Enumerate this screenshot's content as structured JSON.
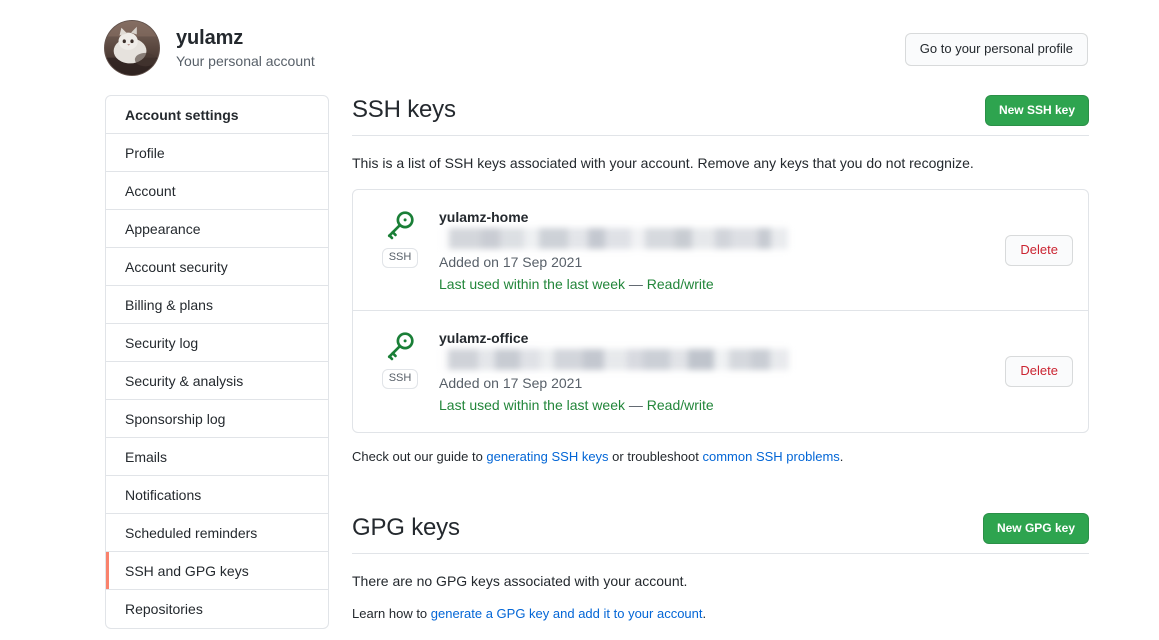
{
  "header": {
    "username": "yulamz",
    "subtitle": "Your personal account",
    "profile_button": "Go to your personal profile",
    "avatar_alt": "cat-avatar"
  },
  "sidebar": {
    "heading": "Account settings",
    "items": [
      {
        "label": "Profile",
        "active": false
      },
      {
        "label": "Account",
        "active": false
      },
      {
        "label": "Appearance",
        "active": false
      },
      {
        "label": "Account security",
        "active": false
      },
      {
        "label": "Billing & plans",
        "active": false
      },
      {
        "label": "Security log",
        "active": false
      },
      {
        "label": "Security & analysis",
        "active": false
      },
      {
        "label": "Sponsorship log",
        "active": false
      },
      {
        "label": "Emails",
        "active": false
      },
      {
        "label": "Notifications",
        "active": false
      },
      {
        "label": "Scheduled reminders",
        "active": false
      },
      {
        "label": "SSH and GPG keys",
        "active": true
      },
      {
        "label": "Repositories",
        "active": false
      }
    ],
    "active_accent_color": "#f9826c"
  },
  "ssh": {
    "title": "SSH keys",
    "new_button": "New SSH key",
    "description": "This is a list of SSH keys associated with your account. Remove any keys that you do not recognize.",
    "keys": [
      {
        "name": "yulamz-home",
        "fingerprint_redacted": true,
        "added": "Added on 17 Sep 2021",
        "last_used": "Last used within the last week",
        "separator": "—",
        "access": "Read/write",
        "delete_label": "Delete",
        "badge": "SSH",
        "icon": "key-icon"
      },
      {
        "name": "yulamz-office",
        "fingerprint_redacted": true,
        "added": "Added on 17 Sep 2021",
        "last_used": "Last used within the last week",
        "separator": "—",
        "access": "Read/write",
        "delete_label": "Delete",
        "badge": "SSH",
        "icon": "key-icon"
      }
    ],
    "guide": {
      "prefix": "Check out our guide to ",
      "link1": "generating SSH keys",
      "middle": " or troubleshoot ",
      "link2": "common SSH problems",
      "suffix": "."
    }
  },
  "gpg": {
    "title": "GPG keys",
    "new_button": "New GPG key",
    "empty": "There are no GPG keys associated with your account.",
    "learn_prefix": "Learn how to ",
    "learn_link": "generate a GPG key and add it to your account",
    "learn_suffix": "."
  },
  "colors": {
    "green_button": "#2ea44f",
    "link": "#0366d6",
    "danger": "#cb2431",
    "success_text": "#22863a",
    "border": "#e1e4e8",
    "muted_text": "#586069"
  }
}
